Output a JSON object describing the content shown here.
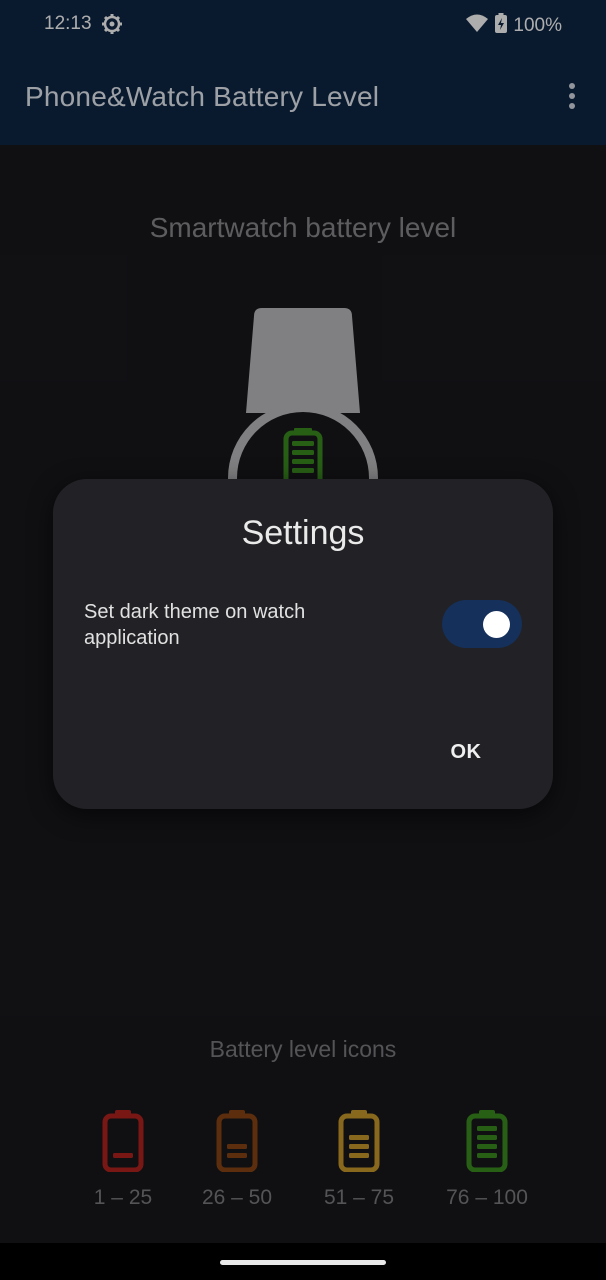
{
  "status_bar": {
    "time": "12:13",
    "settings_icon": "gear-icon",
    "wifi_icon": "wifi-icon",
    "battery_icon": "battery-charging-icon",
    "battery_percent": "100%"
  },
  "app_bar": {
    "title": "Phone&Watch Battery Level",
    "menu_icon": "more-vert-icon",
    "background": "#0e2545"
  },
  "main": {
    "watch_heading": "Smartwatch battery level",
    "watch_battery_icon": "battery-full-icon",
    "icons_heading": "Battery level icons",
    "legend": [
      {
        "label": "1 – 25",
        "color": "#b3231f",
        "bars": 1
      },
      {
        "label": "26 – 50",
        "color": "#8a4416",
        "bars": 2
      },
      {
        "label": "51 – 75",
        "color": "#c79a2a",
        "bars": 3
      },
      {
        "label": "76 – 100",
        "color": "#3a8d20",
        "bars": 4
      }
    ]
  },
  "dialog": {
    "title": "Settings",
    "setting_label": "Set dark theme on watch application",
    "toggle_on": true,
    "toggle_color": "#15305a",
    "ok_label": "OK"
  }
}
